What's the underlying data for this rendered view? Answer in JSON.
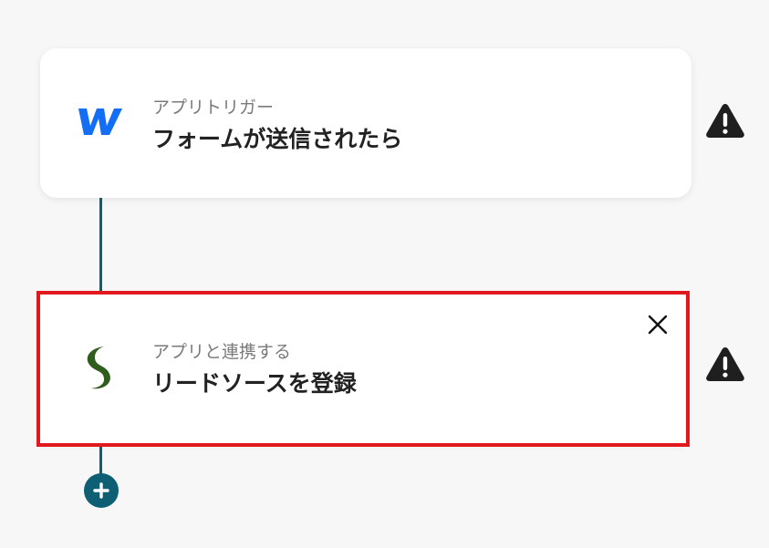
{
  "steps": [
    {
      "subtitle": "アプリトリガー",
      "title": "フォームが送信されたら",
      "app_icon": "webflow-icon",
      "warning_icon": "warning-icon"
    },
    {
      "subtitle": "アプリと連携する",
      "title": "リードソースを登録",
      "app_icon": "leadsource-icon",
      "warning_icon": "warning-icon",
      "close_icon": "close-icon",
      "highlighted": true
    }
  ],
  "add_step_icon": "plus-icon",
  "colors": {
    "connector": "#0e5f73",
    "highlight_border": "#e1191e",
    "webflow_blue": "#146ef5",
    "leadsource_green": "#2f5d1e",
    "warning": "#1f1f1f"
  }
}
